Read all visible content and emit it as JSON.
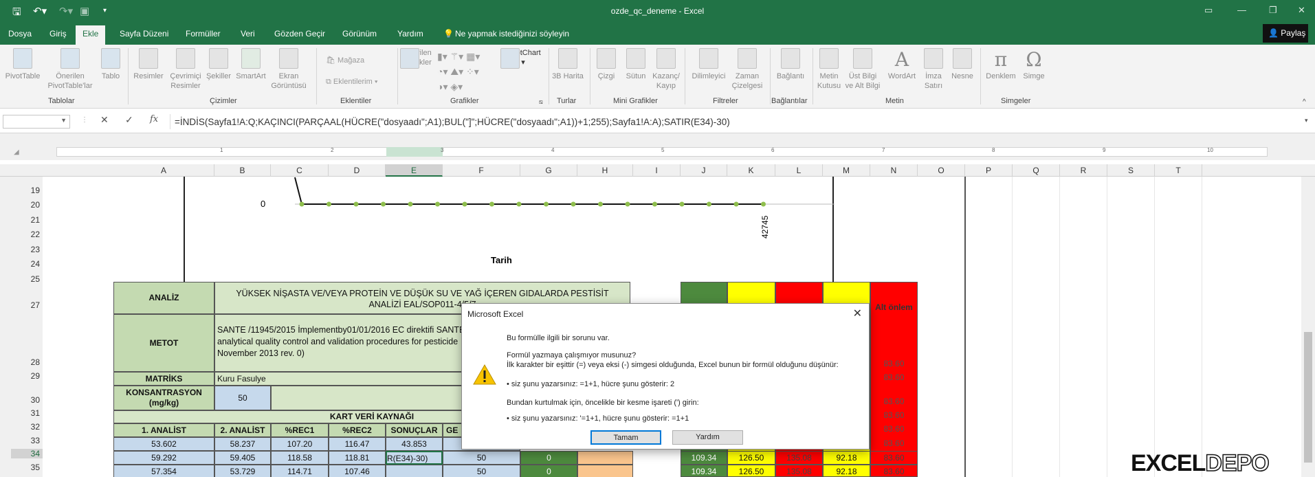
{
  "window": {
    "title": "ozde_qc_deneme  -  Excel",
    "accent": "#217346"
  },
  "tabs": [
    "Dosya",
    "Giriş",
    "Ekle",
    "Sayfa Düzeni",
    "Formüller",
    "Veri",
    "Gözden Geçir",
    "Görünüm",
    "Yardım"
  ],
  "tell_me": "Ne yapmak istediğinizi söyleyin",
  "share": "Paylaş",
  "ribbon": {
    "pivottable": "PivotTable",
    "rec_pivot1": "Önerilen",
    "rec_pivot2": "PivotTable'lar",
    "table": "Tablo",
    "pictures": "Resimler",
    "online_pic1": "Çevrimiçi",
    "online_pic2": "Resimler",
    "shapes": "Şekiller",
    "smartart": "SmartArt",
    "screenshot1": "Ekran",
    "screenshot2": "Görüntüsü",
    "store": "Mağaza",
    "addins": "Eklentilerim",
    "rec_charts1": "Önerilen",
    "rec_charts2": "Grafikler",
    "pivotchart": "PivotChart",
    "map3d": "3B Harita",
    "line": "Çizgi",
    "column": "Sütun",
    "winloss1": "Kazanç/",
    "winloss2": "Kayıp",
    "slicer": "Dilimleyici",
    "timeline1": "Zaman",
    "timeline2": "Çizelgesi",
    "link": "Bağlantı",
    "textbox1": "Metin",
    "textbox2": "Kutusu",
    "header1": "Üst Bilgi",
    "header2": "ve Alt Bilgi",
    "wordart": "WordArt",
    "signature1": "İmza",
    "signature2": "Satırı",
    "object": "Nesne",
    "equation": "Denklem",
    "symbol": "Simge",
    "groups": {
      "tables": "Tablolar",
      "illustrations": "Çizimler",
      "addins": "Eklentiler",
      "charts": "Grafikler",
      "tours": "Turlar",
      "sparklines": "Mini Grafikler",
      "filters": "Filtreler",
      "links": "Bağlantılar",
      "text": "Metin",
      "symbols": "Simgeler"
    }
  },
  "formula": "=İNDİS(Sayfa1!A:Q;KAÇINCI(PARÇAAL(HÜCRE(\"dosyaadı\";A1);BUL(\"]\";HÜCRE(\"dosyaadı\";A1))+1;255);Sayfa1!A:A);SATIR(E34)-30)",
  "ruler": [
    "1",
    "2",
    "3",
    "4",
    "5",
    "6",
    "7",
    "8",
    "9",
    "10"
  ],
  "columns": [
    "A",
    "B",
    "C",
    "D",
    "E",
    "F",
    "G",
    "H",
    "I",
    "J",
    "K",
    "L",
    "M",
    "N",
    "O",
    "P",
    "Q",
    "R",
    "S",
    "T"
  ],
  "rows": [
    "19",
    "20",
    "21",
    "22",
    "23",
    "24",
    "25",
    "27",
    "28",
    "29",
    "30",
    "31",
    "32",
    "33",
    "34",
    "35"
  ],
  "chart": {
    "ytick": "0",
    "xtick": "42745",
    "xlabel": "Tarih"
  },
  "cells": {
    "analiz": "ANALİZ",
    "analiz_val1": "YÜKSEK NİŞASTA VE/VEYA PROTEİN VE DÜŞÜK SU VE YAĞ İÇEREN GIDALARDA PESTİSİT",
    "analiz_val2": "ANALİZİ EAL/SOP011-4/5/7",
    "metot": "METOT",
    "metot_val1": "SANTE /11945/2015 İmplementby01/01/2016 EC direktifi SANTE",
    "metot_val2": "analytical quality control and validation procedures for pesticide",
    "metot_val3": "November 2013 rev. 0)",
    "matriks": "MATRİKS",
    "matriks_val": "Kuru Fasulye",
    "kons1": "KONSANTRASYON",
    "kons2": "(mg/kg)",
    "kons_val": "50",
    "kart": "KART VERİ KAYNAĞI",
    "h_a": "1. ANALİST",
    "h_b": "2. ANALİST",
    "h_c": "%REC1",
    "h_d": "%REC2",
    "h_e": "SONUÇLAR",
    "h_f": "GE",
    "alt_onlem": "Alt önlem",
    "red_val": "83.60"
  },
  "data_rows": [
    {
      "a": "53.602",
      "b": "58.237",
      "c": "107.20",
      "d": "116.47",
      "e": "43.853",
      "f": "",
      "g": "",
      "j": "",
      "k": "",
      "l": "",
      "m": "",
      "n": "83.60"
    },
    {
      "a": "59.292",
      "b": "59.405",
      "c": "118.58",
      "d": "118.81",
      "e": "R(E34)-30)",
      "f": "50",
      "g": "0",
      "j": "109.34",
      "k": "126.50",
      "l": "135.08",
      "m": "92.18",
      "n": "83.60"
    },
    {
      "a": "57.354",
      "b": "53.729",
      "c": "114.71",
      "d": "107.46",
      "e": "",
      "f": "50",
      "g": "0",
      "j": "109.34",
      "k": "126.50",
      "l": "135.08",
      "m": "92.18",
      "n": "83.60"
    }
  ],
  "dialog": {
    "title": "Microsoft Excel",
    "l1": "Bu formülle ilgili bir sorunu var.",
    "l2": "Formül yazmaya çalışmıyor musunuz?",
    "l3": "İlk karakter bir eşittir (=) veya eksi (-) simgesi olduğunda, Excel bunun bir formül olduğunu düşünür:",
    "l4": "• siz şunu yazarsınız:   =1+1, hücre şunu gösterir:   2",
    "l5": "Bundan kurtulmak için, öncelikle bir kesme işareti (') girin:",
    "l6": "• siz şunu yazarsınız:   '=1+1, hücre şunu gösterir:   =1+1",
    "ok": "Tamam",
    "help": "Yardım"
  },
  "logo": {
    "a": "EXCEL",
    "b": "DEPO"
  }
}
